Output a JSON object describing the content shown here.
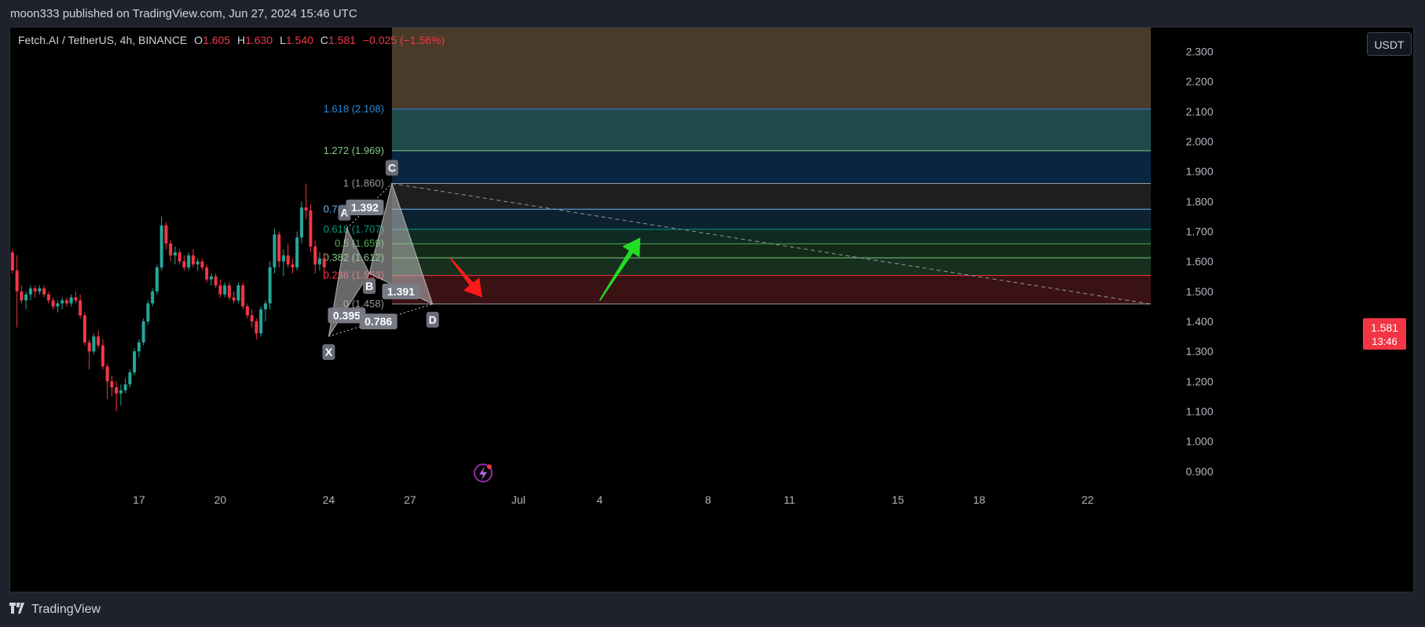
{
  "header": {
    "publisher_text": "moon333 published on TradingView.com, Jun 27, 2024 15:46 UTC"
  },
  "legend": {
    "symbol": "Fetch.AI / TetherUS, 4h, BINANCE",
    "open_label": "O",
    "open": "1.605",
    "high_label": "H",
    "high": "1.630",
    "low_label": "L",
    "low": "1.540",
    "close_label": "C",
    "close": "1.581",
    "change": "−0.025 (−1.56%)"
  },
  "currency_button": "USDT",
  "last_price": {
    "price": "1.581",
    "countdown": "13:46"
  },
  "footer": {
    "logo_text": "TradingView"
  },
  "colors": {
    "up": "#26a69a",
    "down": "#f23645",
    "background": "#000000"
  },
  "chart_data": {
    "type": "candlestick",
    "y_ticks": [
      "0.900",
      "1.000",
      "1.100",
      "1.200",
      "1.300",
      "1.400",
      "1.500",
      "1.600",
      "1.700",
      "1.800",
      "1.900",
      "2.000",
      "2.100",
      "2.200",
      "2.300"
    ],
    "ylim": [
      0.85,
      2.38
    ],
    "x_ticks": [
      "17",
      "20",
      "24",
      "27",
      "Jul",
      "4",
      "8",
      "11",
      "15",
      "18",
      "22"
    ],
    "x_tick_index": [
      28,
      46,
      70,
      88,
      112,
      130,
      154,
      172,
      196,
      214,
      238
    ],
    "xlim": [
      -0.5,
      252
    ],
    "candles": [
      [
        1.63,
        1.64,
        1.56,
        1.57
      ],
      [
        1.57,
        1.62,
        1.38,
        1.5
      ],
      [
        1.5,
        1.52,
        1.46,
        1.47
      ],
      [
        1.47,
        1.5,
        1.44,
        1.49
      ],
      [
        1.49,
        1.52,
        1.47,
        1.51
      ],
      [
        1.51,
        1.52,
        1.48,
        1.5
      ],
      [
        1.5,
        1.52,
        1.49,
        1.51
      ],
      [
        1.51,
        1.52,
        1.48,
        1.49
      ],
      [
        1.49,
        1.5,
        1.46,
        1.47
      ],
      [
        1.47,
        1.48,
        1.44,
        1.45
      ],
      [
        1.45,
        1.47,
        1.43,
        1.46
      ],
      [
        1.46,
        1.48,
        1.44,
        1.47
      ],
      [
        1.47,
        1.48,
        1.45,
        1.46
      ],
      [
        1.46,
        1.49,
        1.45,
        1.48
      ],
      [
        1.48,
        1.5,
        1.46,
        1.47
      ],
      [
        1.47,
        1.49,
        1.41,
        1.42
      ],
      [
        1.42,
        1.43,
        1.32,
        1.33
      ],
      [
        1.33,
        1.34,
        1.24,
        1.3
      ],
      [
        1.3,
        1.36,
        1.29,
        1.35
      ],
      [
        1.35,
        1.37,
        1.31,
        1.32
      ],
      [
        1.32,
        1.34,
        1.24,
        1.25
      ],
      [
        1.25,
        1.26,
        1.14,
        1.2
      ],
      [
        1.2,
        1.22,
        1.15,
        1.18
      ],
      [
        1.18,
        1.2,
        1.1,
        1.16
      ],
      [
        1.16,
        1.19,
        1.12,
        1.17
      ],
      [
        1.17,
        1.21,
        1.16,
        1.19
      ],
      [
        1.19,
        1.24,
        1.18,
        1.23
      ],
      [
        1.23,
        1.31,
        1.22,
        1.3
      ],
      [
        1.3,
        1.34,
        1.28,
        1.33
      ],
      [
        1.33,
        1.41,
        1.32,
        1.4
      ],
      [
        1.4,
        1.47,
        1.39,
        1.46
      ],
      [
        1.46,
        1.51,
        1.45,
        1.5
      ],
      [
        1.5,
        1.59,
        1.49,
        1.58
      ],
      [
        1.58,
        1.75,
        1.57,
        1.72
      ],
      [
        1.72,
        1.73,
        1.64,
        1.66
      ],
      [
        1.66,
        1.67,
        1.6,
        1.62
      ],
      [
        1.62,
        1.65,
        1.59,
        1.63
      ],
      [
        1.63,
        1.64,
        1.59,
        1.6
      ],
      [
        1.6,
        1.62,
        1.57,
        1.58
      ],
      [
        1.58,
        1.63,
        1.57,
        1.62
      ],
      [
        1.62,
        1.64,
        1.58,
        1.59
      ],
      [
        1.59,
        1.61,
        1.57,
        1.6
      ],
      [
        1.6,
        1.61,
        1.57,
        1.58
      ],
      [
        1.58,
        1.59,
        1.53,
        1.54
      ],
      [
        1.54,
        1.56,
        1.52,
        1.55
      ],
      [
        1.55,
        1.56,
        1.51,
        1.52
      ],
      [
        1.52,
        1.54,
        1.48,
        1.49
      ],
      [
        1.49,
        1.53,
        1.48,
        1.52
      ],
      [
        1.52,
        1.53,
        1.47,
        1.48
      ],
      [
        1.48,
        1.5,
        1.46,
        1.47
      ],
      [
        1.47,
        1.53,
        1.46,
        1.52
      ],
      [
        1.52,
        1.53,
        1.44,
        1.45
      ],
      [
        1.45,
        1.46,
        1.41,
        1.42
      ],
      [
        1.42,
        1.44,
        1.38,
        1.4
      ],
      [
        1.4,
        1.41,
        1.34,
        1.36
      ],
      [
        1.36,
        1.45,
        1.35,
        1.44
      ],
      [
        1.44,
        1.47,
        1.4,
        1.46
      ],
      [
        1.46,
        1.6,
        1.44,
        1.58
      ],
      [
        1.58,
        1.71,
        1.56,
        1.69
      ],
      [
        1.69,
        1.7,
        1.58,
        1.6
      ],
      [
        1.6,
        1.64,
        1.55,
        1.62
      ],
      [
        1.62,
        1.66,
        1.58,
        1.59
      ],
      [
        1.59,
        1.61,
        1.56,
        1.58
      ],
      [
        1.58,
        1.7,
        1.57,
        1.68
      ],
      [
        1.68,
        1.8,
        1.66,
        1.78
      ],
      [
        1.78,
        1.86,
        1.74,
        1.77
      ],
      [
        1.77,
        1.79,
        1.63,
        1.65
      ],
      [
        1.65,
        1.67,
        1.56,
        1.59
      ],
      [
        1.59,
        1.63,
        1.57,
        1.61
      ],
      [
        1.61,
        1.63,
        1.54,
        1.58
      ]
    ],
    "candle_start_index": 0,
    "harmonic_pattern": {
      "points": [
        {
          "label": "X",
          "i": 70,
          "y": 1.35
        },
        {
          "label": "A",
          "i": 74,
          "y": 1.71
        },
        {
          "label": "B",
          "i": 79,
          "y": 1.56
        },
        {
          "label": "C",
          "i": 84,
          "y": 1.86
        },
        {
          "label": "D",
          "i": 93,
          "y": 1.458
        }
      ],
      "ratios": [
        {
          "text": "0.395",
          "i": 74,
          "y": 1.42
        },
        {
          "text": "1.392",
          "i": 78,
          "y": 1.78
        },
        {
          "text": "1.391",
          "i": 86,
          "y": 1.5
        },
        {
          "text": "0.786",
          "i": 81,
          "y": 1.4
        }
      ]
    },
    "fib_levels": [
      {
        "ratio": "1.618",
        "text": "1.618 (2.108)",
        "value": 2.108,
        "color": "#2a87d6"
      },
      {
        "ratio": "1.272",
        "text": "1.272 (1.969)",
        "value": 1.969,
        "color": "#81c784"
      },
      {
        "ratio": "1",
        "text": "1 (1.860)",
        "value": 1.86,
        "color": "#9598a1"
      },
      {
        "ratio": "0.786",
        "text": "0.786 (1.774)",
        "value": 1.774,
        "color": "#64b5f6"
      },
      {
        "ratio": "0.618",
        "text": "0.618 (1.707)",
        "value": 1.707,
        "color": "#089981"
      },
      {
        "ratio": "0.5",
        "text": "0.5 (1.659)",
        "value": 1.659,
        "color": "#4caf50"
      },
      {
        "ratio": "0.382",
        "text": "0.382 (1.612)",
        "value": 1.612,
        "color": "#81c784"
      },
      {
        "ratio": "0.236",
        "text": "0.236 (1.553)",
        "value": 1.553,
        "color": "#f23645"
      },
      {
        "ratio": "0",
        "text": "0 (1.458)",
        "value": 1.458,
        "color": "#9598a1"
      }
    ],
    "fib_start_index": 84,
    "fib_end_index": 252,
    "fib_top_value": 2.38,
    "fib_zone_colors": [
      "#4a3a2a",
      "#1f4a4a",
      "#082541",
      "#1e1e1e",
      "#0c2230",
      "#0f2a22",
      "#142a18",
      "#17301e",
      "#3a1214"
    ],
    "trendline": {
      "i1": 84,
      "y1": 1.86,
      "i2": 252,
      "y2": 1.458
    },
    "arrows": [
      {
        "name": "red-arrow",
        "color": "#ff1a1a",
        "from_i": 97,
        "from_y": 1.61,
        "to_i": 104,
        "to_y": 1.48
      },
      {
        "name": "green-arrow",
        "color": "#22dd22",
        "from_i": 130,
        "from_y": 1.47,
        "to_i": 139,
        "to_y": 1.68
      }
    ]
  }
}
